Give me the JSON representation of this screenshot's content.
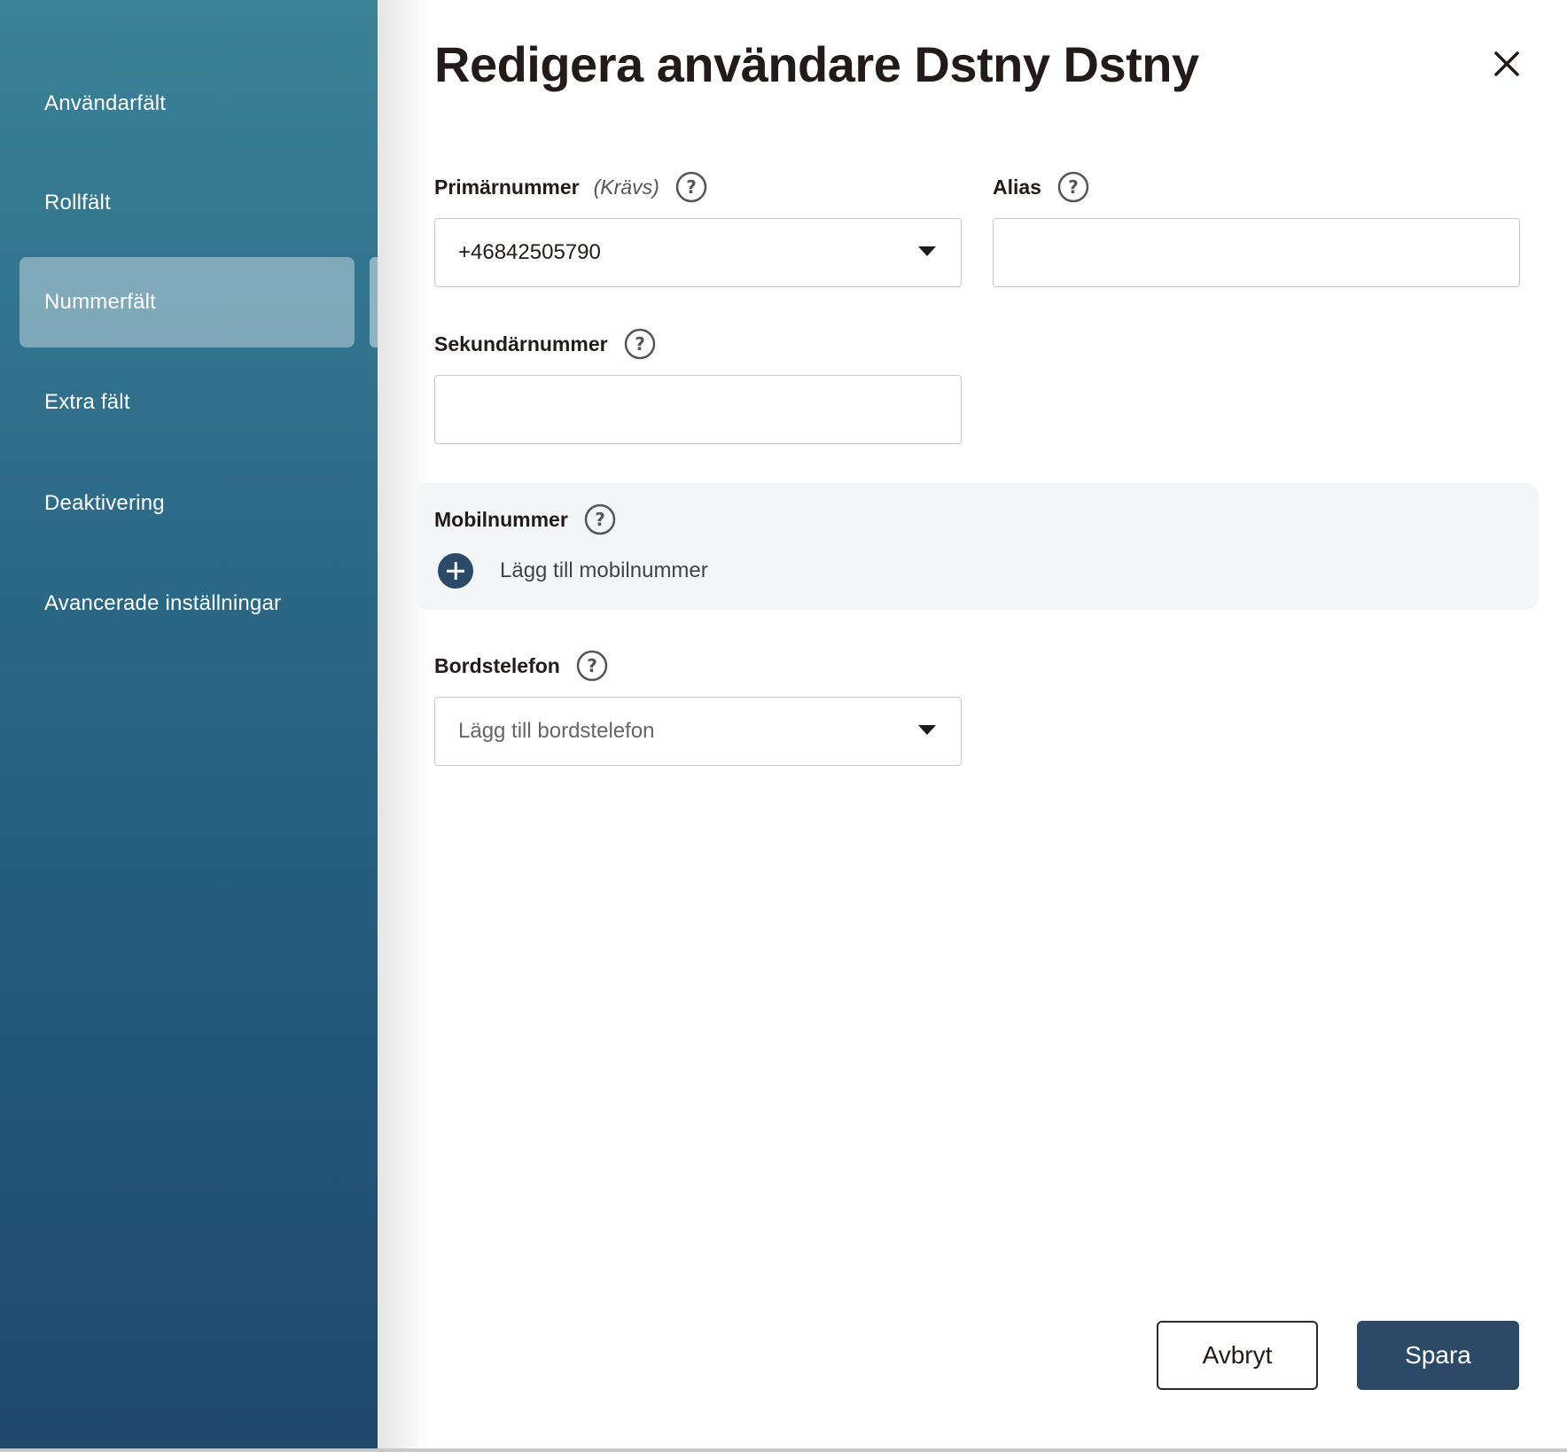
{
  "sidebar": {
    "items": [
      {
        "label": "Användarfält"
      },
      {
        "label": "Rollfält"
      },
      {
        "label": "Nummerfält",
        "active": true
      },
      {
        "label": "Extra fält"
      },
      {
        "label": "Deaktivering"
      },
      {
        "label": "Avancerade inställningar"
      }
    ]
  },
  "dialog": {
    "title": "Redigera användare Dstny Dstny",
    "close_icon": "close-icon"
  },
  "fields": {
    "primary": {
      "label": "Primärnummer",
      "required_note": "(Krävs)",
      "value": "+46842505790"
    },
    "alias": {
      "label": "Alias",
      "value": ""
    },
    "secondary": {
      "label": "Sekundärnummer",
      "value": ""
    },
    "mobile": {
      "label": "Mobilnummer",
      "add_label": "Lägg till mobilnummer"
    },
    "desk_phone": {
      "label": "Bordstelefon",
      "placeholder": "Lägg till bordstelefon"
    }
  },
  "actions": {
    "cancel_label": "Avbryt",
    "save_label": "Spara"
  },
  "colors": {
    "sidebar_top": "#3a8296",
    "sidebar_bottom": "#1d4a6c",
    "primary_button": "#2c4a68",
    "text": "#231a1a"
  }
}
